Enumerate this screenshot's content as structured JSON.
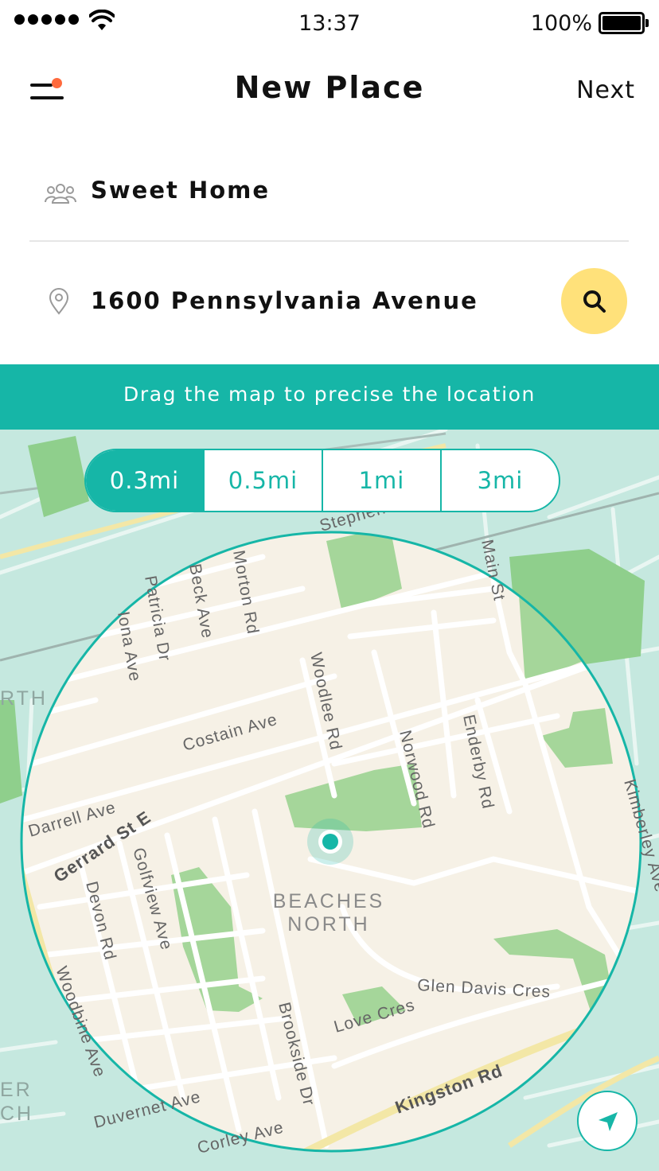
{
  "status_bar": {
    "time": "13:37",
    "battery_percent": "100%",
    "signal_bars": 5,
    "icons": [
      "signal-dots-icon",
      "wifi-icon",
      "battery-icon"
    ]
  },
  "nav": {
    "title": "New Place",
    "next_label": "Next",
    "menu_icon": "menu-notification-icon"
  },
  "form": {
    "name": {
      "icon": "group-people-icon",
      "value": "Sweet Home"
    },
    "address": {
      "icon": "location-pin-icon",
      "value": "1600 Pennsylvania Avenue",
      "search_icon": "search-icon"
    }
  },
  "banner": {
    "text": "Drag the map to precise the location"
  },
  "radius": {
    "options": [
      "0.3mi",
      "0.5mi",
      "1mi",
      "3mi"
    ],
    "selected": "0.3mi"
  },
  "map": {
    "area_label_line1": "BEACHES",
    "area_label_line2": "NORTH",
    "partial_labels": [
      "RTH",
      "ER",
      "CH"
    ],
    "streets": [
      "Stephens",
      "Main St",
      "Morton Rd",
      "Beck Ave",
      "Patricia Dr",
      "Iona Ave",
      "Woodlee Rd",
      "Costain Ave",
      "Norwood Rd",
      "Enderby Rd",
      "Kimberley Ave",
      "Darrell Ave",
      "Gerrard St E",
      "Golfview Ave",
      "Devon Rd",
      "Glen Davis Cres",
      "Love Cres",
      "Brookside Dr",
      "Woodbine Ave",
      "Duvernet Ave",
      "Corley Ave",
      "Kingston Rd"
    ],
    "accent_color": "#16b6a7",
    "locate_icon": "navigation-arrow-icon"
  },
  "colors": {
    "accent": "#16b6a7",
    "search_button": "#ffe17a",
    "notification_dot": "#ff6a3d"
  }
}
